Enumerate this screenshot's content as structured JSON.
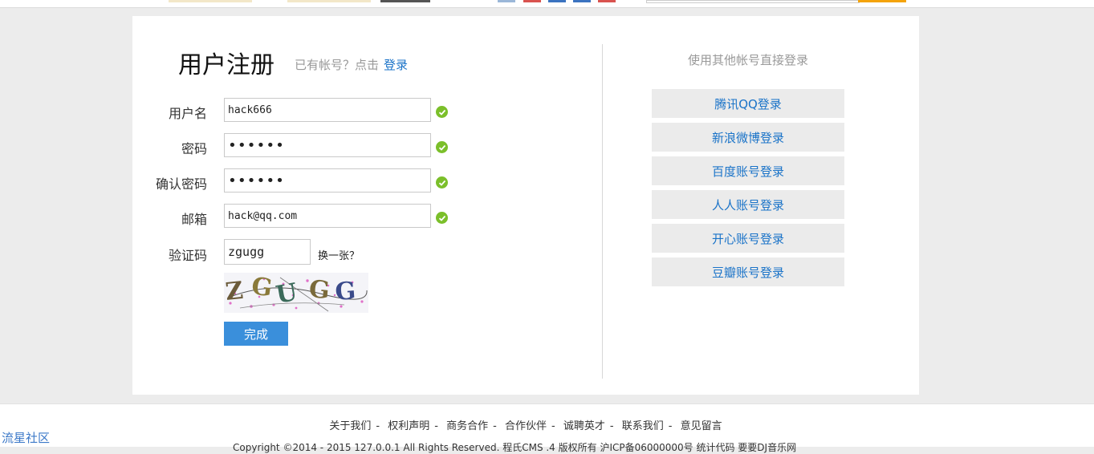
{
  "header": {
    "title": "用户注册",
    "login_prompt": "已有帐号？点击",
    "login_link": "登录"
  },
  "form": {
    "username": {
      "label": "用户名",
      "value": "hack666"
    },
    "password": {
      "label": "密码",
      "value": "••••••"
    },
    "confirm_password": {
      "label": "确认密码",
      "value": "••••••"
    },
    "email": {
      "label": "邮箱",
      "value": "hack@qq.com"
    },
    "captcha": {
      "label": "验证码",
      "value": "zgugg",
      "refresh_label": "换一张？",
      "image_text": "ZGUGG"
    },
    "submit_label": "完成"
  },
  "social": {
    "title": "使用其他帐号直接登录",
    "buttons": [
      "腾讯QQ登录",
      "新浪微博登录",
      "百度账号登录",
      "人人账号登录",
      "开心账号登录",
      "豆瓣账号登录"
    ]
  },
  "footer": {
    "links": [
      "关于我们",
      "权利声明",
      "商务合作",
      "合作伙伴",
      "诚聘英才",
      "联系我们",
      "意见留言"
    ],
    "copyright": "Copyright ©2014 - 2015 127.0.0.1 All Rights Reserved. 程氏CMS .4 版权所有 沪ICP备06000000号 统计代码 要要DJ音乐网"
  },
  "community_link": "流星社区",
  "colors": {
    "accent": "#3a8fdb",
    "link": "#1a73c8",
    "success": "#7bbf2a",
    "background": "#ececec"
  }
}
